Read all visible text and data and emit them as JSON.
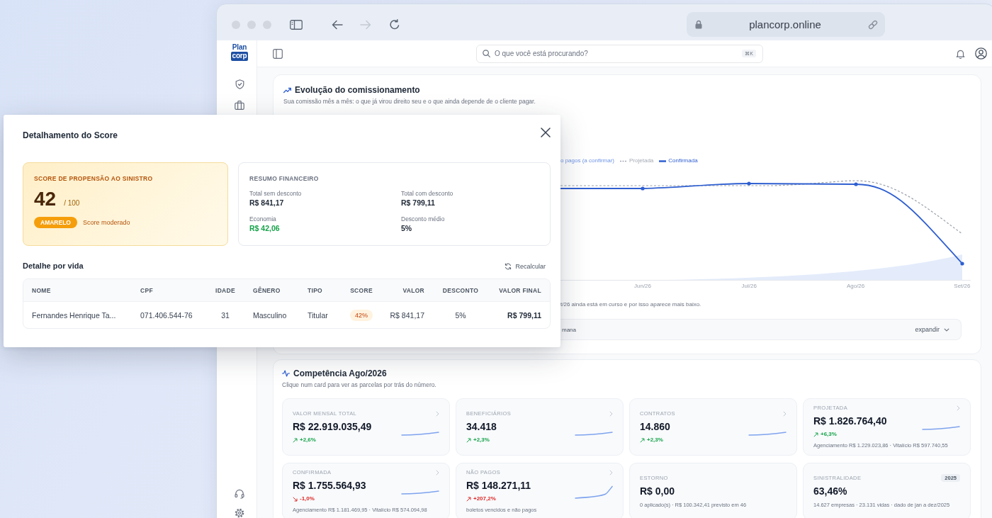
{
  "browser": {
    "url": "plancorp.online",
    "forward_disabled": true
  },
  "app": {
    "logo": {
      "top": "Plan",
      "bottom": "corp"
    },
    "search": {
      "placeholder": "O que você está procurando?",
      "shortcut": "⌘K"
    }
  },
  "commission": {
    "title": "Evolução do comissionamento",
    "subtitle": "Sua comissão mês a mês: o que já virou direito seu e o que ainda depende de o cliente pagar.",
    "legend": [
      {
        "label": "o pagos (a confirmar)",
        "kind": "area"
      },
      {
        "label": "Projetada",
        "kind": "dashed"
      },
      {
        "label": "Confirmada",
        "kind": "solid"
      }
    ],
    "x_labels": [
      "Jun/26",
      "Jul/26",
      "Ago/26",
      "Set/26"
    ],
    "note": "t/26 ainda está em curso e por isso aparece mais baixo.",
    "period_chip": "mana",
    "expand_label": "expandir"
  },
  "competence": {
    "title": "Competência Ago/2026",
    "subtitle": "Clique num card para ver as parcelas por trás do número.",
    "cards": [
      {
        "label": "VALOR MENSAL TOTAL",
        "value": "R$ 22.919.035,49",
        "change": "+2,6%",
        "up": true,
        "positive": true,
        "sparkline": true,
        "spike": false,
        "chevron": true
      },
      {
        "label": "BENEFICIÁRIOS",
        "value": "34.418",
        "change": "+2,3%",
        "up": true,
        "positive": true,
        "sparkline": true,
        "spike": false,
        "chevron": true
      },
      {
        "label": "CONTRATOS",
        "value": "14.860",
        "change": "+2,3%",
        "up": true,
        "positive": true,
        "sparkline": true,
        "spike": false,
        "chevron": true
      },
      {
        "label": "PROJETADA",
        "value": "R$ 1.826.764,40",
        "change": "+6,3%",
        "up": true,
        "positive": true,
        "sparkline": true,
        "spike": false,
        "chevron": true,
        "detail": "Agenciamento R$ 1.229.023,86 · Vitalício R$ 597.740,55"
      },
      {
        "label": "CONFIRMADA",
        "value": "R$ 1.755.564,93",
        "change": "-1,0%",
        "up": false,
        "positive": false,
        "sparkline": true,
        "spike": false,
        "chevron": true,
        "detail": "Agenciamento R$ 1.181.469,95 · Vitalício R$ 574.094,98"
      },
      {
        "label": "NÃO PAGOS",
        "value": "R$ 148.271,11",
        "change": "+207,2%",
        "up": true,
        "positive": false,
        "sparkline": true,
        "spike": true,
        "chevron": true,
        "detail": "boletos vencidos e não pagos"
      },
      {
        "label": "ESTORNO",
        "value": "R$ 0,00",
        "sparkline": false,
        "chevron": false,
        "detail": "0 aplicado(s) · R$ 100.342,41 previsto em 46"
      },
      {
        "label": "SINISTRALIDADE",
        "value": "63,46%",
        "sparkline": false,
        "chevron": false,
        "badge": "2025",
        "detail": "14.627 empresas · 23.131 vidas · dado de jan a dez/2025"
      }
    ]
  },
  "score_modal": {
    "title": "Detalhamento do Score",
    "score": {
      "label": "SCORE DE PROPENSÃO AO SINISTRO",
      "value": "42",
      "scale": "/ 100",
      "badge": "AMARELO",
      "description": "Score moderado"
    },
    "summary": {
      "title": "RESUMO FINANCEIRO",
      "items": [
        {
          "label": "Total sem desconto",
          "value": "R$ 841,17",
          "positive": false
        },
        {
          "label": "Total com desconto",
          "value": "R$ 799,11",
          "positive": false
        },
        {
          "label": "Economia",
          "value": "R$ 42,06",
          "positive": true
        },
        {
          "label": "Desconto médio",
          "value": "5%",
          "positive": false
        }
      ]
    },
    "detail_title": "Detalhe por vida",
    "recalc_label": "Recalcular",
    "table": {
      "columns": [
        "NOME",
        "CPF",
        "IDADE",
        "GÊNERO",
        "TIPO",
        "SCORE",
        "VALOR",
        "DESCONTO",
        "VALOR FINAL"
      ],
      "rows": [
        {
          "name": "Fernandes Henrique Ta...",
          "cpf": "071.406.544-76",
          "age": "31",
          "gender": "Masculino",
          "type": "Titular",
          "score": "42%",
          "value": "R$ 841,17",
          "discount": "5%",
          "final_value": "R$ 799,11"
        }
      ]
    }
  }
}
